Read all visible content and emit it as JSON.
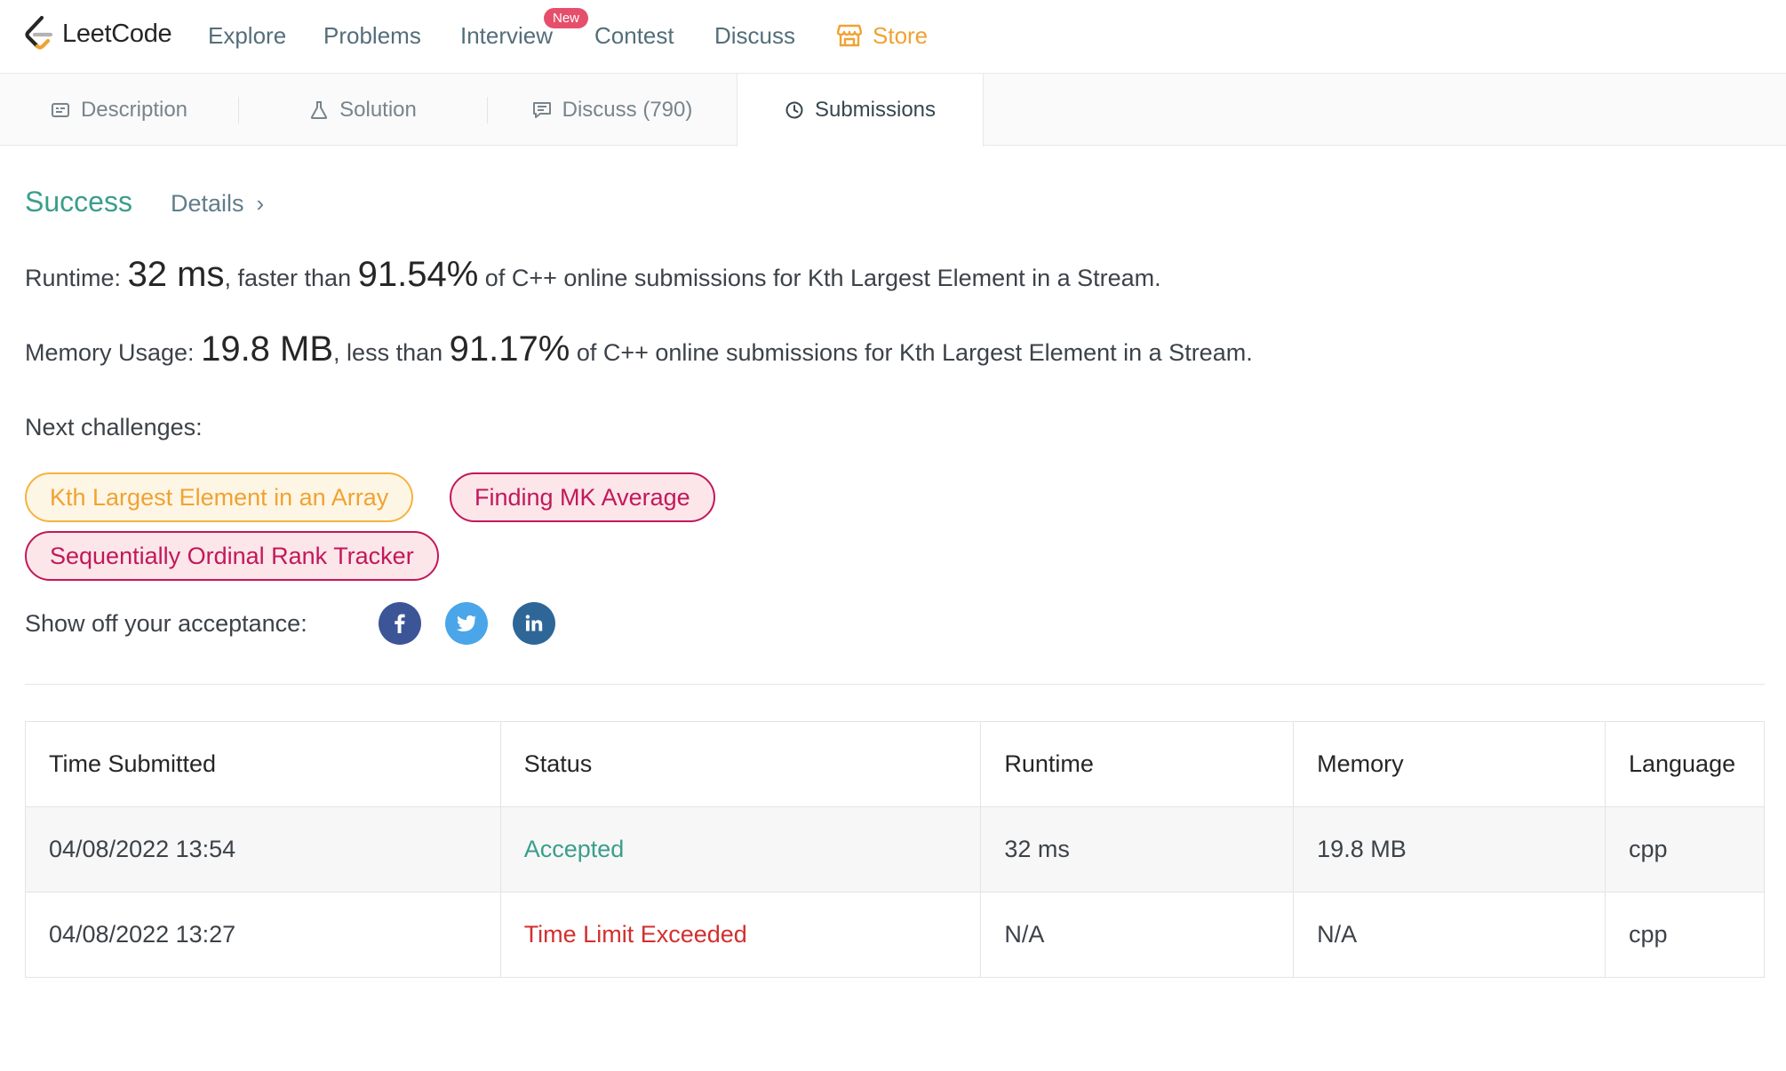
{
  "header": {
    "logo_text": "LeetCode",
    "nav": {
      "explore": "Explore",
      "problems": "Problems",
      "interview": "Interview",
      "interview_badge": "New",
      "contest": "Contest",
      "discuss": "Discuss",
      "store": "Store"
    },
    "colors": {
      "store": "#f0a233",
      "badge": "#e64f6c"
    }
  },
  "tabs": {
    "description": "Description",
    "solution": "Solution",
    "discuss": "Discuss (790)",
    "submissions": "Submissions",
    "active": "submissions"
  },
  "result": {
    "status": "Success",
    "details_label": "Details",
    "runtime": {
      "label": "Runtime:",
      "value": "32 ms",
      "comparison": ", faster than",
      "percent": "91.54%",
      "suffix": "of C++ online submissions for Kth Largest Element in a Stream."
    },
    "memory": {
      "label": "Memory Usage:",
      "value": "19.8 MB",
      "comparison": ", less than",
      "percent": "91.17%",
      "suffix": "of C++ online submissions for Kth Largest Element in a Stream."
    },
    "next_label": "Next challenges:",
    "challenges": [
      {
        "title": "Kth Largest Element in an Array",
        "difficulty": "medium"
      },
      {
        "title": "Finding MK Average",
        "difficulty": "hard"
      },
      {
        "title": "Sequentially Ordinal Rank Tracker",
        "difficulty": "hard"
      }
    ],
    "share_label": "Show off your acceptance:",
    "share_icons": [
      "facebook-icon",
      "twitter-icon",
      "linkedin-icon"
    ],
    "colors": {
      "success": "#3a9e8c",
      "error": "#d32f2f",
      "medium": "#f0a233",
      "hard": "#c2185b"
    }
  },
  "submissions": {
    "columns": [
      "Time Submitted",
      "Status",
      "Runtime",
      "Memory",
      "Language"
    ],
    "rows": [
      {
        "time": "04/08/2022 13:54",
        "status": "Accepted",
        "runtime": "32 ms",
        "memory": "19.8 MB",
        "language": "cpp"
      },
      {
        "time": "04/08/2022 13:27",
        "status": "Time Limit Exceeded",
        "runtime": "N/A",
        "memory": "N/A",
        "language": "cpp"
      }
    ]
  }
}
